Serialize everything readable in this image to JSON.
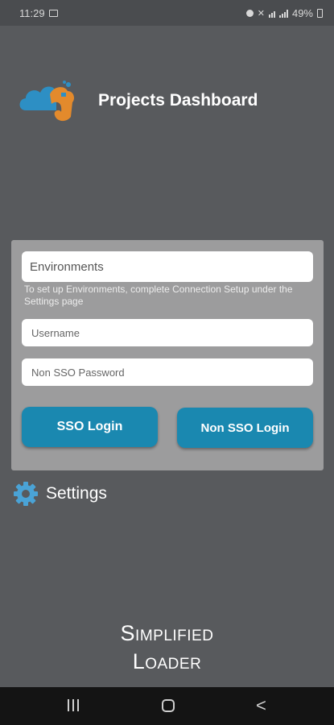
{
  "status_bar": {
    "time": "11:29",
    "battery": "49%"
  },
  "app": {
    "title": "Projects Dashboard",
    "logo_icon": "cloud-logo-icon",
    "colors": {
      "background": "#585a5d",
      "panel": "#9c9c9d",
      "button": "#1a88b0",
      "logo_blue": "#2d8fc4",
      "logo_orange": "#e38a2c"
    }
  },
  "login": {
    "environments_label": "Environments",
    "helper_text": "To set up Environments, complete Connection Setup under the Settings page",
    "username_placeholder": "Username",
    "password_placeholder": "Non SSO Password",
    "sso_button": "SSO Login",
    "non_sso_button": "Non SSO Login"
  },
  "settings": {
    "label": "Settings",
    "icon": "gear-icon"
  },
  "brand": {
    "line1": "Simplified",
    "line2": "Loader"
  },
  "nav": {
    "recents_icon": "recents-icon",
    "home_icon": "home-icon",
    "back_icon": "back-icon",
    "back_glyph": "<"
  }
}
